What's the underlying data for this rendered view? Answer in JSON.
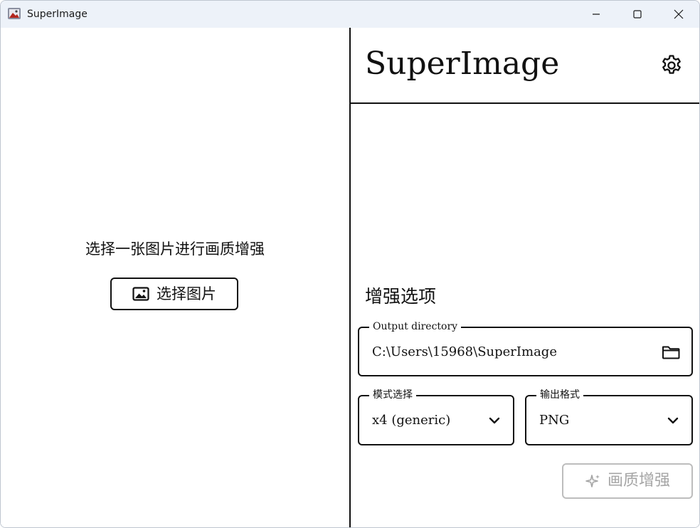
{
  "window": {
    "title": "SuperImage"
  },
  "left": {
    "prompt": "选择一张图片进行画质增强",
    "select_button_label": "选择图片",
    "select_button_icon": "image-icon"
  },
  "right": {
    "app_title": "SuperImage",
    "settings_icon": "gear-icon",
    "section_title": "增强选项",
    "output": {
      "label": "Output directory",
      "value": "C:\\Users\\15968\\SuperImage",
      "icon": "folder-icon"
    },
    "mode": {
      "label": "模式选择",
      "value": "x4 (generic)"
    },
    "format": {
      "label": "输出格式",
      "value": "PNG"
    },
    "enhance_button_label": "画质增强",
    "enhance_button_icon": "sparkle-icon"
  },
  "colors": {
    "titlebar": "#edf2f9",
    "border": "#111111",
    "disabled": "#a5a5a5"
  }
}
